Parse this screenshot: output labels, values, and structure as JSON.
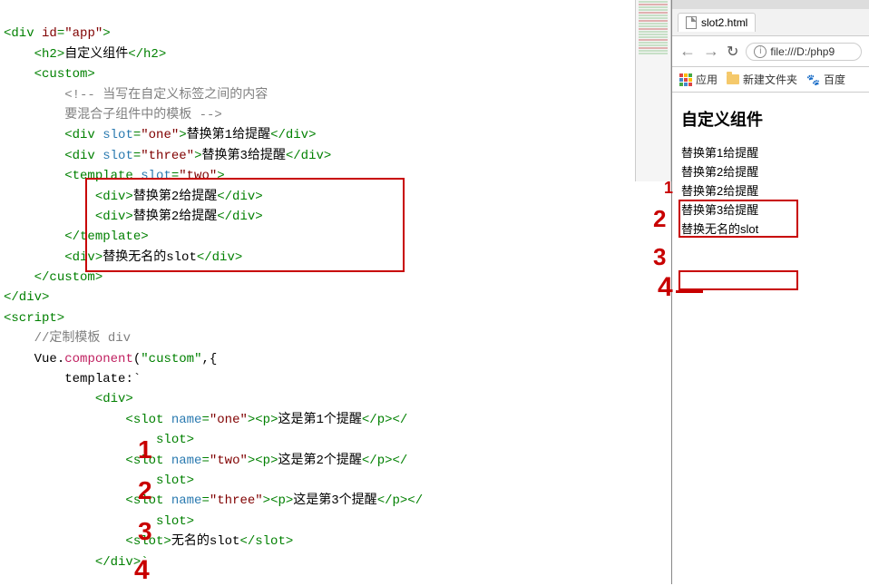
{
  "code": {
    "l1": {
      "tag_open": "<div ",
      "attr": "id",
      "val": "\"app\"",
      "close": ">"
    },
    "l2": {
      "open": "<h2>",
      "txt": "自定义组件",
      "close": "</h2>"
    },
    "l3": {
      "open": "<custom>"
    },
    "l4": {
      "comment": "<!-- 当写在自定义标签之间的内容"
    },
    "l5": {
      "comment": "要混合子组件中的模板 -->"
    },
    "l6": {
      "open": "<div ",
      "attr": "slot",
      "val": "\"one\"",
      "mid": ">",
      "txt": "替换第1给提醒",
      "close": "</div>"
    },
    "l7": {
      "open": "<div ",
      "attr": "slot",
      "val": "\"three\"",
      "mid": ">",
      "txt": "替换第3给提醒",
      "close": "</div>"
    },
    "l8": {
      "open": "<template ",
      "attr": "slot",
      "val": "\"two\"",
      "close": ">"
    },
    "l9": {
      "open": "<div>",
      "txt": "替换第2给提醒",
      "close": "</div>"
    },
    "l10": {
      "open": "<div>",
      "txt": "替换第2给提醒",
      "close": "</div>"
    },
    "l11": {
      "close": "</template>"
    },
    "l12": {
      "open": "<div>",
      "txt": "替换无名的slot",
      "close": "</div>"
    },
    "l13": {
      "close": "</custom>"
    },
    "l14": {
      "close": "</div>"
    },
    "l15": {
      "open": "<script>"
    },
    "l16": {
      "comment": "//定制模板 div"
    },
    "l17": {
      "vue": "Vue",
      "dot": ".",
      "comp": "component",
      "paren": "(",
      "str": "\"custom\"",
      "rest": ",{"
    },
    "l18": {
      "key": "template",
      "colon": ":`"
    },
    "l19": {
      "open": "<div>"
    },
    "l20": {
      "open": "<slot ",
      "attr": "name",
      "val": "\"one\"",
      "mid": "><p>",
      "txt": "这是第1个提醒",
      "close1": "</p></",
      "close2": "slot>"
    },
    "l21": {
      "open": "<slot ",
      "attr": "name",
      "val": "\"two\"",
      "mid": "><p>",
      "txt": "这是第2个提醒",
      "close1": "</p></",
      "close2": "slot>"
    },
    "l22": {
      "open": "<slot ",
      "attr": "name",
      "val": "\"three\"",
      "mid": "><p>",
      "txt": "这是第3个提醒",
      "close1": "</p></",
      "close2": "slot>"
    },
    "l23": {
      "open": "<slot>",
      "txt": "无名的slot",
      "close": "</slot>"
    },
    "l24": {
      "close": "</div>`"
    }
  },
  "annotations": {
    "n1": "1",
    "n2": "2",
    "n3": "3",
    "n4": "4",
    "r1": "1",
    "r2": "2",
    "r3": "3",
    "r4": "4"
  },
  "browser": {
    "tab": "slot2.html",
    "url": "file:///D:/php9",
    "bookmarks": {
      "apps": "应用",
      "folder": "新建文件夹",
      "baidu": "百度"
    },
    "page": {
      "title": "自定义组件",
      "lines": [
        "替换第1给提醒",
        "替换第2给提醒",
        "替换第2给提醒",
        "替换第3给提醒",
        "替换无名的slot"
      ]
    }
  }
}
